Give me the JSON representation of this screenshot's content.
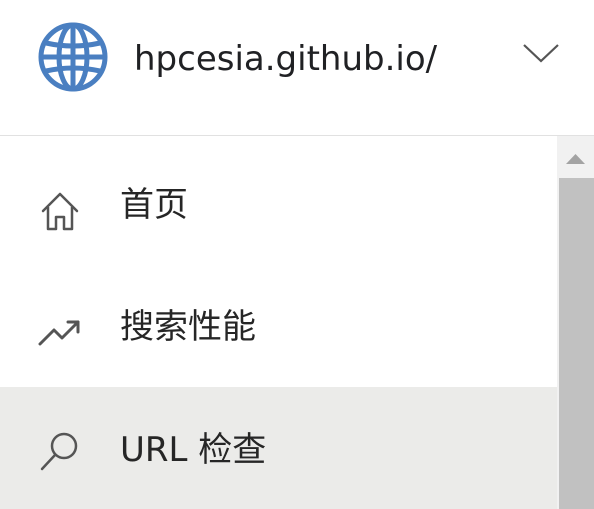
{
  "header": {
    "site": "hpcesia.github.io/",
    "site_icon": "globe-icon",
    "dropdown_icon": "chevron-down-icon"
  },
  "nav": {
    "items": [
      {
        "label": "首页",
        "icon": "home-icon",
        "selected": false
      },
      {
        "label": "搜索性能",
        "icon": "trending-up-icon",
        "selected": false
      },
      {
        "label": "URL 检查",
        "icon": "search-icon",
        "selected": true
      }
    ]
  },
  "colors": {
    "globe": "#4a7fc1",
    "selected_bg": "#ebebe9",
    "text": "#262626",
    "scrollbar_track": "#f1f1f1",
    "scrollbar_thumb": "#c1c1c1"
  }
}
